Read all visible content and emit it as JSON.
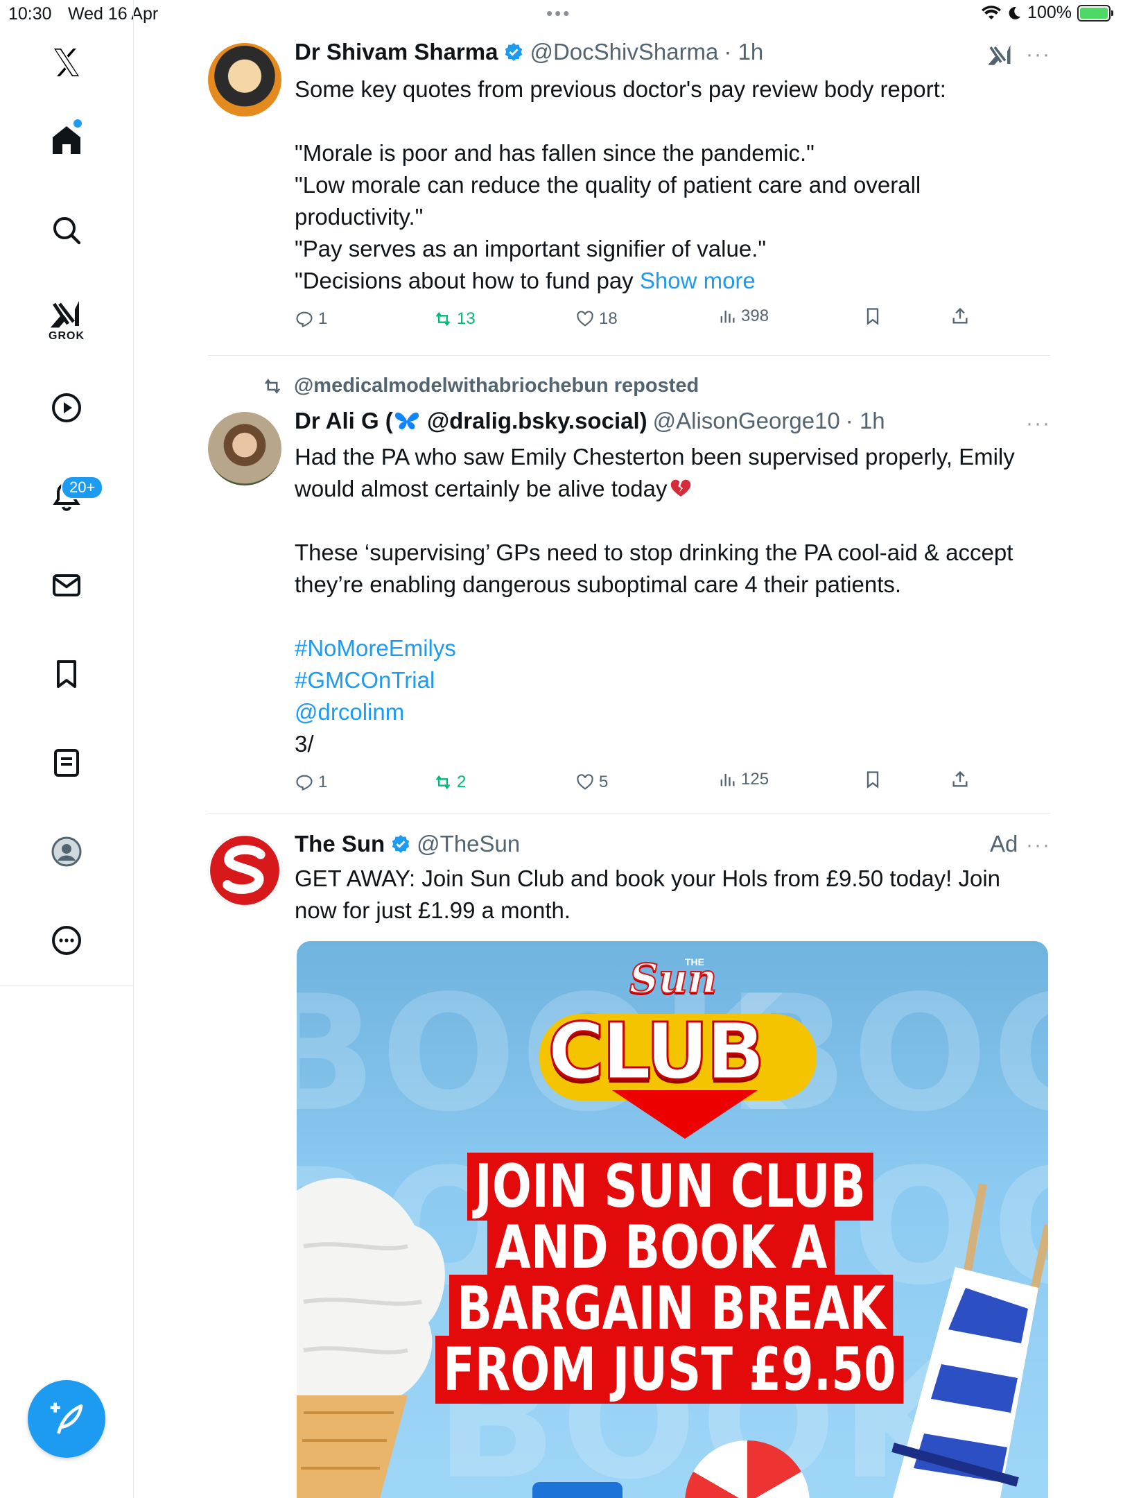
{
  "status_bar": {
    "time": "10:30",
    "date": "Wed 16 Apr",
    "battery_text": "100%"
  },
  "sidebar": {
    "items": [
      {
        "name": "home",
        "icon": "home-icon"
      },
      {
        "name": "explore",
        "icon": "search-icon"
      },
      {
        "name": "grok",
        "icon": "grok-icon",
        "label": "GROK"
      },
      {
        "name": "video",
        "icon": "play-icon"
      },
      {
        "name": "notifications",
        "icon": "bell-icon",
        "badge": "20+"
      },
      {
        "name": "messages",
        "icon": "mail-icon"
      },
      {
        "name": "bookmarks",
        "icon": "bookmark-icon"
      },
      {
        "name": "lists",
        "icon": "list-icon"
      },
      {
        "name": "profile",
        "icon": "profile-icon"
      },
      {
        "name": "more",
        "icon": "more-icon"
      }
    ],
    "compose_icon": "compose-icon"
  },
  "tweets": [
    {
      "name": "Dr Shivam Sharma",
      "handle": "@DocShivSharma",
      "time": "· 1h",
      "lines": [
        "Some key quotes from previous doctor's pay review body report:",
        "",
        "\"Morale is poor and has fallen since the pandemic.\"",
        "\"Low morale can reduce the quality of patient care and overall",
        "productivity.\"",
        "\"Pay serves as an important signifier of value.\"",
        "\"Decisions about how to fund pay"
      ],
      "show_more": "Show more",
      "replies": "1",
      "reposts": "13",
      "likes": "18",
      "views": "398"
    },
    {
      "reposted_by": "@medicalmodelwithabriochebun reposted",
      "name_prefix": "Dr Ali G (",
      "name_suffix": " @dralig.bsky.social)",
      "handle": "@AlisonGeorge10",
      "time": "· 1h",
      "line1": "Had the PA who saw Emily Chesterton been supervised properly, Emily",
      "line2": "would almost certainly be alive today",
      "line3": "These ‘supervising’ GPs need to stop drinking the PA cool-aid & accept",
      "line4": "they’re enabling dangerous suboptimal care 4 their patients.",
      "tags": [
        "#NoMoreEmilys",
        "#GMCOnTrial",
        "@drcolinm"
      ],
      "tail": "3/",
      "replies": "1",
      "reposts": "2",
      "likes": "5",
      "views": "125"
    },
    {
      "name": "The Sun",
      "handle": "@TheSun",
      "ad_label": "Ad",
      "line1": "GET AWAY: Join Sun Club and book your Hols from £9.50 today! Join",
      "line2": "now for just £1.99 a month.",
      "image": {
        "the": "THE",
        "sun": "Sun",
        "club": "CLUB",
        "bg_word": "BOOK",
        "headline": [
          "JOIN SUN CLUB",
          "AND BOOK A",
          "BARGAIN BREAK",
          "FROM JUST £9.50"
        ]
      }
    }
  ],
  "colors": {
    "accent": "#1d9bf0",
    "repost_green": "#00ba7c",
    "sun_red": "#e20a0a",
    "text": "#0f1419",
    "muted": "#536471"
  }
}
